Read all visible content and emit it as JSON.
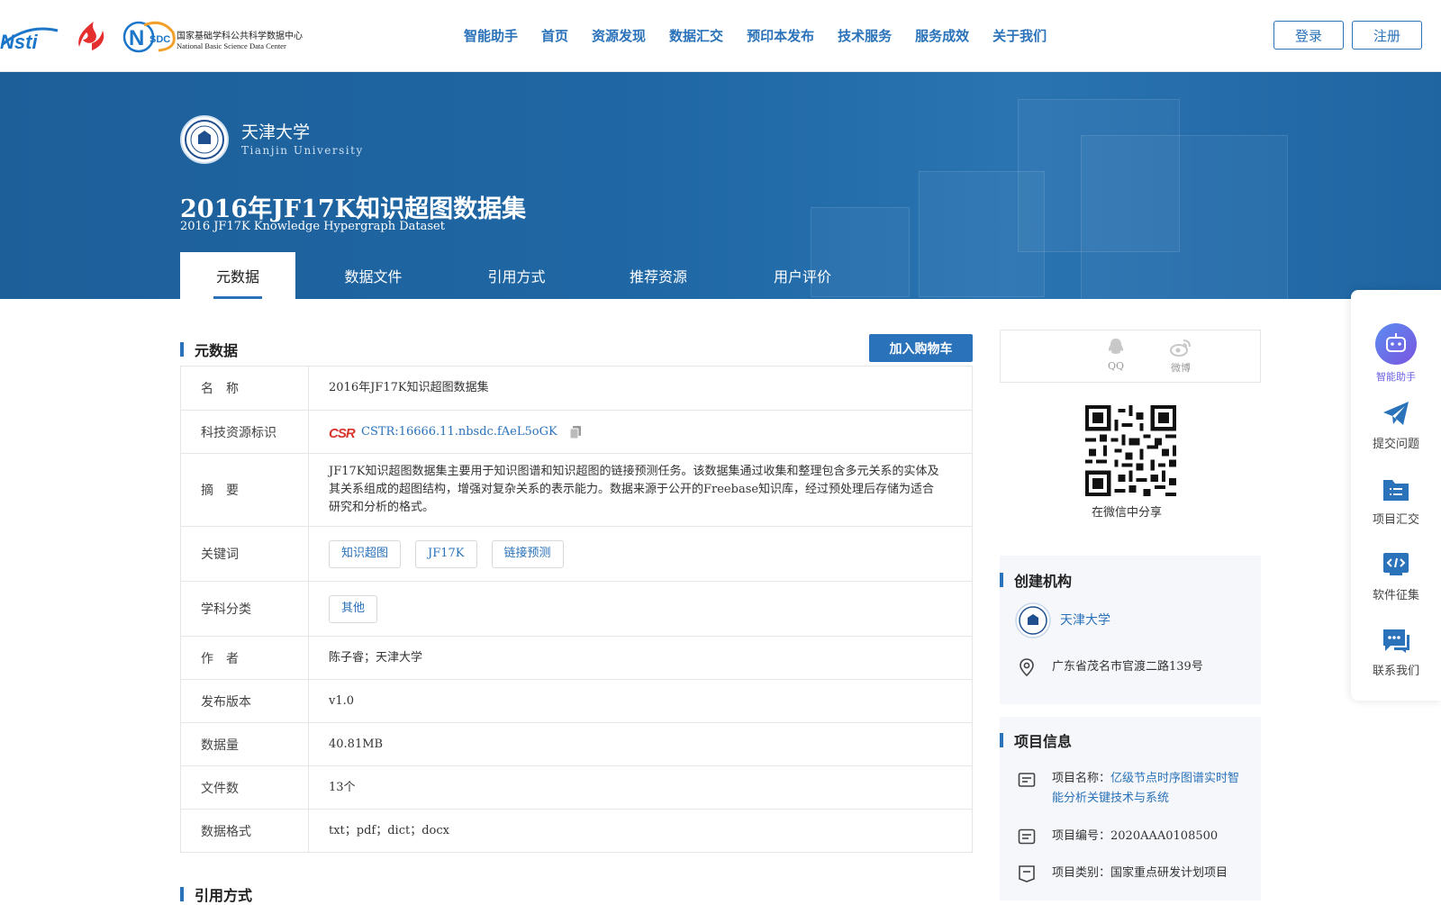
{
  "header": {
    "logo_nsdc_cn": "国家基础学科公共科学数据中心",
    "logo_nsdc_en": "National Basic Science Data Center",
    "logo_nsdc_abbr": "SDC",
    "logo_nsti_text": "Nsti",
    "nav": [
      "智能助手",
      "首页",
      "资源发现",
      "数据汇交",
      "预印本发布",
      "技术服务",
      "服务成效",
      "关于我们"
    ],
    "login": "登录",
    "register": "注册"
  },
  "banner": {
    "university_cn": "天津大学",
    "university_en": "Tianjin University",
    "title_cn": "2016年JF17K知识超图数据集",
    "title_en": "2016 JF17K Knowledge Hypergraph Dataset",
    "tabs": [
      "元数据",
      "数据文件",
      "引用方式",
      "推荐资源",
      "用户评价"
    ]
  },
  "metadata": {
    "section_title": "元数据",
    "cart_button": "加入购物车",
    "rows": {
      "name_label": "名　称",
      "name_value": "2016年JF17K知识超图数据集",
      "cstr_label": "科技资源标识",
      "cstr_value": "CSTR:16666.11.nbsdc.fAeL5oGK",
      "cstr_badge": "CSTR",
      "abstract_label": "摘　要",
      "abstract_value": "JF17K知识超图数据集主要用于知识图谱和知识超图的链接预测任务。该数据集通过收集和整理包含多元关系的实体及其关系组成的超图结构，增强对复杂关系的表示能力。数据来源于公开的Freebase知识库，经过预处理后存储为适合研究和分析的格式。",
      "keywords_label": "关键词",
      "keywords": [
        "知识超图",
        "JF17K",
        "链接预测"
      ],
      "subject_label": "学科分类",
      "subject_value": "其他",
      "author_label": "作　者",
      "author_value": "陈子睿；天津大学",
      "version_label": "发布版本",
      "version_value": "v1.0",
      "size_label": "数据量",
      "size_value": "40.81MB",
      "files_label": "文件数",
      "files_value": "13个",
      "format_label": "数据格式",
      "format_value": "txt；pdf；dict；docx"
    }
  },
  "citation": {
    "section_title": "引用方式"
  },
  "share": {
    "qq": "QQ",
    "weibo": "微博",
    "wechat_caption": "在微信中分享"
  },
  "creator": {
    "section_title": "创建机构",
    "org": "天津大学",
    "address": "广东省茂名市官渡二路139号"
  },
  "project": {
    "section_title": "项目信息",
    "name_label": "项目名称：",
    "name_value": "亿级节点时序图谱实时智能分析关键技术与系统",
    "code_label": "项目编号：",
    "code_value": "2020AAA0108500",
    "type_label": "项目类别：",
    "type_value": "国家重点研发计划项目"
  },
  "floatbar": {
    "items": [
      "智能助手",
      "提交问题",
      "项目汇交",
      "软件征集",
      "联系我们"
    ]
  },
  "colors": {
    "primary": "#2a72b9",
    "banner": "#1f67a5",
    "assistant": "#6b63e8"
  }
}
